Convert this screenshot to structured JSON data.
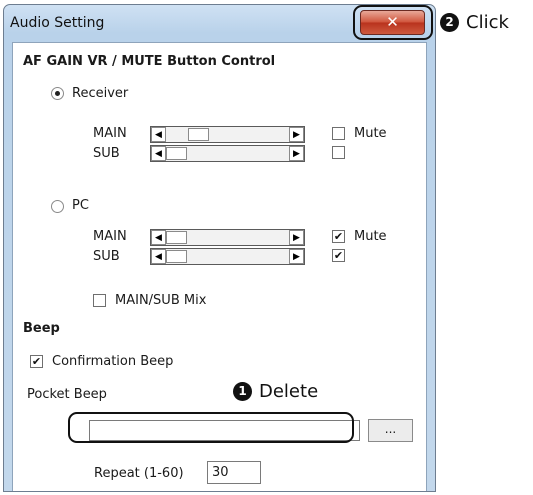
{
  "window": {
    "title": "Audio Setting"
  },
  "sections": {
    "af_gain_title": "AF GAIN VR / MUTE Button Control",
    "beep_title": "Beep"
  },
  "receiver": {
    "label": "Receiver",
    "selected": true,
    "main": {
      "label": "MAIN",
      "level": 0.25,
      "mute_label": "Mute",
      "muted": false
    },
    "sub": {
      "label": "SUB",
      "level": 0.0,
      "muted": false
    }
  },
  "pc": {
    "label": "PC",
    "selected": false,
    "main": {
      "label": "MAIN",
      "level": 0.0,
      "mute_label": "Mute",
      "muted": true
    },
    "sub": {
      "label": "SUB",
      "level": 0.0,
      "muted": true
    }
  },
  "mix": {
    "label": "MAIN/SUB Mix",
    "checked": false
  },
  "beep": {
    "confirmation_label": "Confirmation Beep",
    "confirmation_checked": true,
    "pocket_label": "Pocket Beep",
    "pocket_value": "",
    "browse_label": "...",
    "repeat_label": "Repeat (1-60)",
    "repeat_value": "30"
  },
  "callouts": {
    "click": {
      "number": "2",
      "text": "Click"
    },
    "delete": {
      "number": "1",
      "text": "Delete"
    }
  },
  "icons": {
    "close": "close-x-icon",
    "slider_left": "arrow-left-icon",
    "slider_right": "arrow-right-icon",
    "check": "check-icon"
  }
}
